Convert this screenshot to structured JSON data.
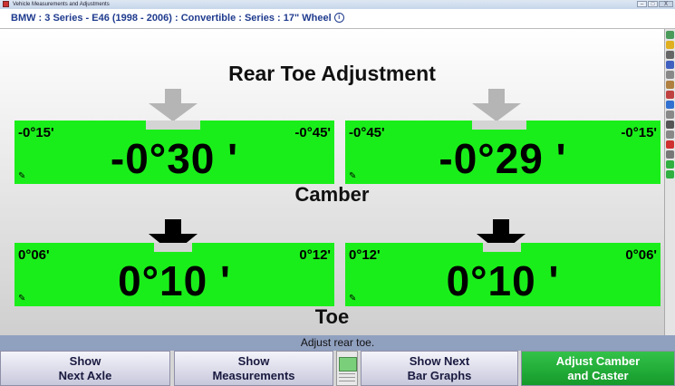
{
  "window": {
    "title": "Vehicle Measurements and Adjustments",
    "buttons": [
      "–",
      "□",
      "X"
    ]
  },
  "vehicle": {
    "text": "BMW : 3 Series - E46 (1998 - 2006) : Convertible : Series : 17\" Wheel",
    "info_icon": "info-icon"
  },
  "main": {
    "heading_top": "Rear Toe Adjustment",
    "heading_mid": "Camber",
    "heading_bottom": "Toe",
    "panels": [
      {
        "left_label": "-0°15'",
        "right_label": "-0°45'",
        "value": "-0°30 '",
        "arrow": "gray"
      },
      {
        "left_label": "-0°45'",
        "right_label": "-0°15'",
        "value": "-0°29 '",
        "arrow": "gray"
      },
      {
        "left_label": "0°06'",
        "right_label": "0°12'",
        "value": "0°10 '",
        "arrow": "black"
      },
      {
        "left_label": "0°12'",
        "right_label": "0°06'",
        "value": "0°10 '",
        "arrow": "black"
      }
    ],
    "pen_icon": "pencil-icon"
  },
  "status": "Adjust rear toe.",
  "bottom": {
    "btn1": [
      "Show",
      "Next Axle"
    ],
    "btn2": [
      "Show",
      "Measurements"
    ],
    "btn3": [
      "Show Next",
      "Bar Graphs"
    ],
    "btn4": [
      "Adjust Camber",
      "and Caster"
    ]
  },
  "colors": {
    "panel": "#1aee1a",
    "status_bar": "#90a0bf",
    "title": "#1f3b8e",
    "accent_button": "#159a2a"
  }
}
